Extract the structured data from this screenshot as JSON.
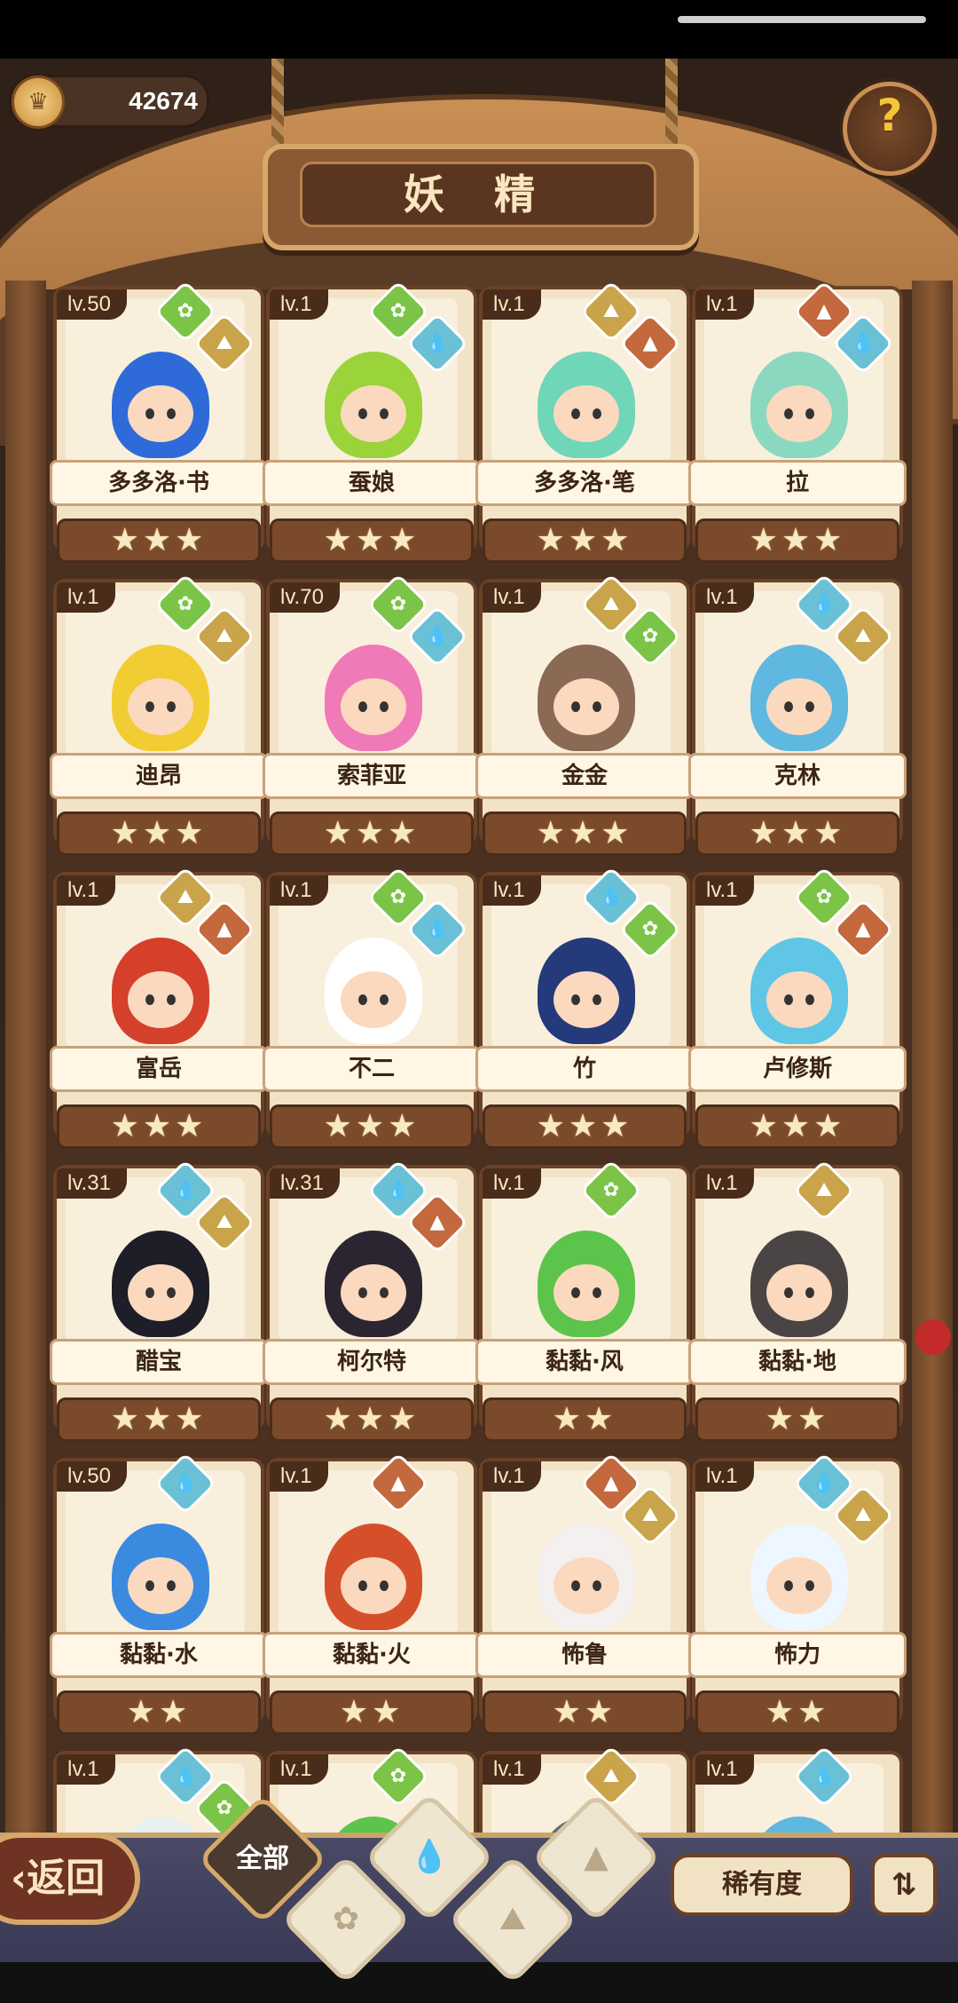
{
  "header": {
    "coins": "42674",
    "title": "妖 精",
    "help_icon": "question-mark"
  },
  "colors": {
    "grass": "#7bc447",
    "earth": "#c9a44a",
    "water": "#6ac1d6",
    "fire": "#c4683e"
  },
  "cards": [
    {
      "level": "lv.50",
      "name": "多多洛·书",
      "stars": "★★★",
      "elements": [
        "grass",
        "earth"
      ],
      "hair": "#2f6bd8"
    },
    {
      "level": "lv.1",
      "name": "蚕娘",
      "stars": "★★★",
      "elements": [
        "grass",
        "water"
      ],
      "hair": "#9ad33a"
    },
    {
      "level": "lv.1",
      "name": "多多洛·笔",
      "stars": "★★★",
      "elements": [
        "earth",
        "fire"
      ],
      "hair": "#6fd6b8"
    },
    {
      "level": "lv.1",
      "name": "拉",
      "stars": "★★★",
      "elements": [
        "fire",
        "water"
      ],
      "hair": "#8ad8c0"
    },
    {
      "level": "lv.1",
      "name": "迪昂",
      "stars": "★★★",
      "elements": [
        "grass",
        "earth"
      ],
      "hair": "#f2cc33"
    },
    {
      "level": "lv.70",
      "name": "索菲亚",
      "stars": "★★★",
      "elements": [
        "grass",
        "water"
      ],
      "hair": "#f07ab8"
    },
    {
      "level": "lv.1",
      "name": "金金",
      "stars": "★★★",
      "elements": [
        "earth",
        "grass"
      ],
      "hair": "#8a6a55"
    },
    {
      "level": "lv.1",
      "name": "克林",
      "stars": "★★★",
      "elements": [
        "water",
        "earth"
      ],
      "hair": "#5fb8e0"
    },
    {
      "level": "lv.1",
      "name": "富岳",
      "stars": "★★★",
      "elements": [
        "earth",
        "fire"
      ],
      "hair": "#d5402a"
    },
    {
      "level": "lv.1",
      "name": "不二",
      "stars": "★★★",
      "elements": [
        "grass",
        "water"
      ],
      "hair": "#ffffff"
    },
    {
      "level": "lv.1",
      "name": "竹",
      "stars": "★★★",
      "elements": [
        "water",
        "grass"
      ],
      "hair": "#253a7a"
    },
    {
      "level": "lv.1",
      "name": "卢修斯",
      "stars": "★★★",
      "elements": [
        "grass",
        "fire"
      ],
      "hair": "#5fc6e6"
    },
    {
      "level": "lv.31",
      "name": "醋宝",
      "stars": "★★★",
      "elements": [
        "water",
        "earth"
      ],
      "hair": "#1e1e28"
    },
    {
      "level": "lv.31",
      "name": "柯尔特",
      "stars": "★★★",
      "elements": [
        "water",
        "fire"
      ],
      "hair": "#2a2530"
    },
    {
      "level": "lv.1",
      "name": "黏黏·风",
      "stars": "★★",
      "elements": [
        "grass"
      ],
      "hair": "#5cc44a"
    },
    {
      "level": "lv.1",
      "name": "黏黏·地",
      "stars": "★★",
      "elements": [
        "earth"
      ],
      "hair": "#4a4444"
    },
    {
      "level": "lv.50",
      "name": "黏黏·水",
      "stars": "★★",
      "elements": [
        "water"
      ],
      "hair": "#3a8ae0"
    },
    {
      "level": "lv.1",
      "name": "黏黏·火",
      "stars": "★★",
      "elements": [
        "fire"
      ],
      "hair": "#d5502a"
    },
    {
      "level": "lv.1",
      "name": "怖鲁",
      "stars": "★★",
      "elements": [
        "fire",
        "earth"
      ],
      "hair": "#f4f0f0"
    },
    {
      "level": "lv.1",
      "name": "怖力",
      "stars": "★★",
      "elements": [
        "water",
        "earth"
      ],
      "hair": "#eef6ff"
    },
    {
      "level": "lv.1",
      "name": "",
      "stars": "",
      "elements": [
        "water",
        "grass"
      ],
      "hair": "#e8f0f0"
    },
    {
      "level": "lv.1",
      "name": "",
      "stars": "",
      "elements": [
        "grass"
      ],
      "hair": "#5cc44a"
    },
    {
      "level": "lv.1",
      "name": "",
      "stars": "",
      "elements": [
        "earth"
      ],
      "hair": "#6a6a6a"
    },
    {
      "level": "lv.1",
      "name": "",
      "stars": "",
      "elements": [
        "water"
      ],
      "hair": "#5fb8e0"
    }
  ],
  "bottom": {
    "back_label": "返回",
    "tabs": [
      {
        "label": "全部",
        "icon": "all-icon"
      },
      {
        "label": "",
        "icon": "grass-icon"
      },
      {
        "label": "",
        "icon": "water-icon"
      },
      {
        "label": "",
        "icon": "earth-icon"
      },
      {
        "label": "",
        "icon": "fire-icon"
      }
    ],
    "rarity_label": "稀有度",
    "sort_icon": "sort-icon"
  }
}
